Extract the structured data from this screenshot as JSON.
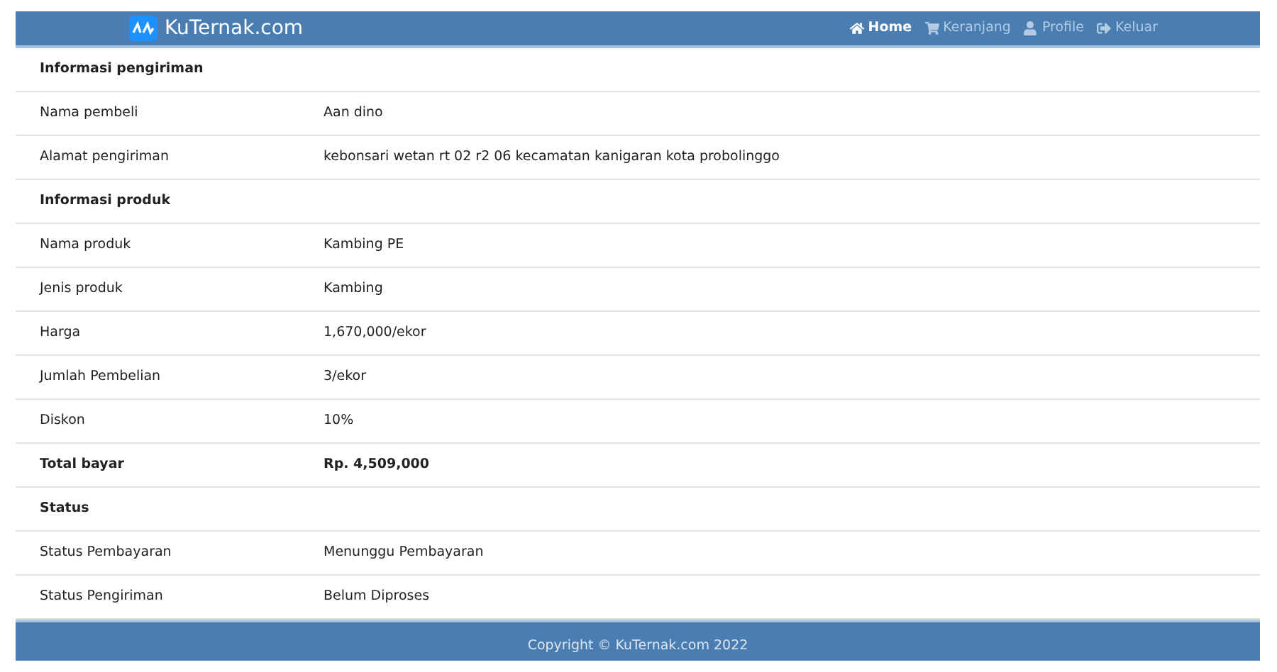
{
  "navbar": {
    "brand": "KuTernak.com",
    "links": [
      {
        "label": "Home",
        "selected": true
      },
      {
        "label": "Keranjang",
        "selected": false
      },
      {
        "label": "Profile",
        "selected": false
      },
      {
        "label": "Keluar",
        "selected": false
      }
    ]
  },
  "rows": [
    {
      "kind": "section",
      "label": "Informasi pengiriman"
    },
    {
      "kind": "field",
      "label": "Nama pembeli",
      "value": "Aan dino"
    },
    {
      "kind": "field",
      "label": "Alamat pengiriman",
      "value": "kebonsari wetan rt 02 r2 06 kecamatan kanigaran kota probolinggo"
    },
    {
      "kind": "section",
      "label": "Informasi produk"
    },
    {
      "kind": "field",
      "label": "Nama produk",
      "value": "Kambing PE"
    },
    {
      "kind": "field",
      "label": "Jenis produk",
      "value": "Kambing"
    },
    {
      "kind": "field",
      "label": "Harga",
      "value": "1,670,000/ekor"
    },
    {
      "kind": "field",
      "label": "Jumlah Pembelian",
      "value": "3/ekor"
    },
    {
      "kind": "field",
      "label": "Diskon",
      "value": "10%"
    },
    {
      "kind": "total",
      "label": "Total bayar",
      "value": "Rp. 4,509,000"
    },
    {
      "kind": "section",
      "label": "Status"
    },
    {
      "kind": "field",
      "label": "Status Pembayaran",
      "value": "Menunggu Pembayaran"
    },
    {
      "kind": "field",
      "label": "Status Pengiriman",
      "value": "Belum Diproses"
    }
  ],
  "footer": {
    "text": "Copyright © KuTernak.com 2022"
  }
}
